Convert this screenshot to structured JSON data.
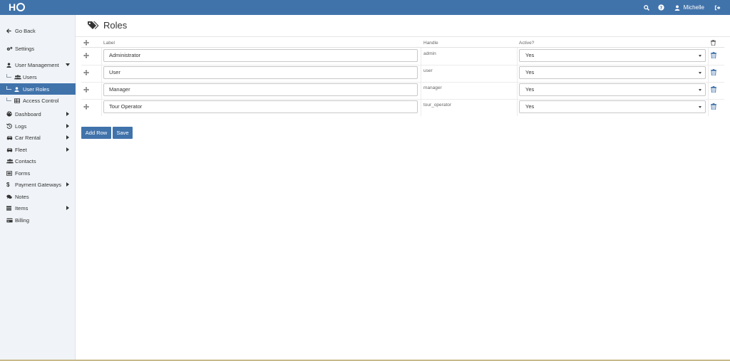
{
  "header": {
    "logo_text": "H",
    "user_name": "Michelle",
    "icons": [
      "search-icon",
      "help-icon",
      "user-icon",
      "logout-icon"
    ]
  },
  "sidebar": {
    "go_back": "Go Back",
    "settings": "Settings",
    "user_management": "User Management",
    "users": "Users",
    "user_roles": "User Roles",
    "access_control": "Access Control",
    "dashboard": "Dashboard",
    "logs": "Logs",
    "car_rental": "Car Rental",
    "fleet": "Fleet",
    "contacts": "Contacts",
    "forms": "Forms",
    "payment_gateways": "Payment Gateways",
    "notes": "Notes",
    "items": "Items",
    "billing": "Billing"
  },
  "page": {
    "title": "Roles",
    "columns": {
      "label": "Label",
      "handle": "Handle",
      "active": "Active?"
    },
    "rows": [
      {
        "label": "Administrator",
        "handle": "admin",
        "active": "Yes"
      },
      {
        "label": "User",
        "handle": "user",
        "active": "Yes"
      },
      {
        "label": "Manager",
        "handle": "manager",
        "active": "Yes"
      },
      {
        "label": "Tour Operator",
        "handle": "tour_operator",
        "active": "Yes"
      }
    ],
    "add_row_label": "Add Row",
    "save_label": "Save"
  },
  "colors": {
    "primary": "#4173ab",
    "sidebar_bg": "#f0f4f8"
  }
}
